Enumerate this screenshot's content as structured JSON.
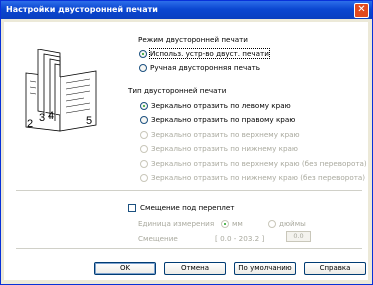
{
  "window": {
    "title": "Настройки двусторонней печати"
  },
  "illustration": {
    "page_numbers": [
      "2",
      "3",
      "4",
      "5"
    ]
  },
  "duplex_mode": {
    "label": "Режим двусторонней печати",
    "options": [
      {
        "label": "Использ. устр-во двуст. печати",
        "selected": true,
        "enabled": true
      },
      {
        "label": "Ручная двусторонняя печать",
        "selected": false,
        "enabled": true
      }
    ]
  },
  "duplex_type": {
    "label": "Тип двусторонней печати",
    "options": [
      {
        "label": "Зеркально отразить по левому краю",
        "selected": true,
        "enabled": true
      },
      {
        "label": "Зеркально отразить по правому краю",
        "selected": false,
        "enabled": true
      },
      {
        "label": "Зеркально отразить по верхнему краю",
        "selected": false,
        "enabled": false
      },
      {
        "label": "Зеркально отразить по нижнему краю",
        "selected": false,
        "enabled": false
      },
      {
        "label": "Зеркально отразить по верхнему краю (без переворота)",
        "selected": false,
        "enabled": false
      },
      {
        "label": "Зеркально отразить по нижнему краю (без переворота)",
        "selected": false,
        "enabled": false
      }
    ]
  },
  "binding_offset": {
    "label": "Смещение под переплет",
    "checked": false,
    "unit_label": "Единица измерения",
    "units": [
      {
        "label": "мм",
        "selected": true
      },
      {
        "label": "дюймы",
        "selected": false
      }
    ],
    "offset_label": "Смещение",
    "range": "[ 0.0 - 203.2 ]",
    "value": "0.0"
  },
  "buttons": {
    "ok": "OK",
    "cancel": "Отмена",
    "default": "По умолчанию",
    "help": "Справка"
  }
}
